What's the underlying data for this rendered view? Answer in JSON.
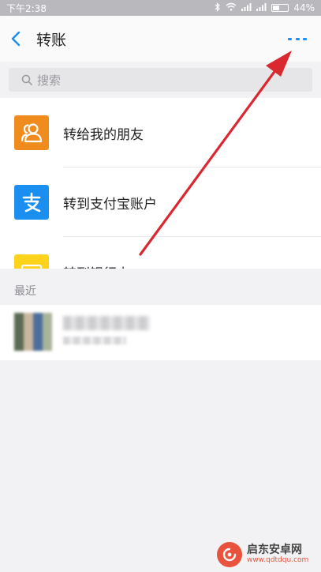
{
  "status_bar": {
    "time": "下午2:38",
    "battery": "44%",
    "battery_level": 0.44
  },
  "header": {
    "title": "转账",
    "back_icon": "chevron-left-icon",
    "more_icon": "more-dots-icon",
    "accent_color": "#1a8ff0"
  },
  "search": {
    "placeholder": "搜索"
  },
  "transfer_options": [
    {
      "label": "转给我的朋友",
      "icon": "contacts-icon",
      "color": "#f08b1e"
    },
    {
      "label": "转到支付宝账户",
      "icon": "alipay-icon",
      "color": "#1a8ff0"
    },
    {
      "label": "转到银行卡",
      "icon": "bank-card-icon",
      "color": "#ffd21c"
    }
  ],
  "recent": {
    "header": "最近"
  },
  "watermark": {
    "title": "启东安卓网",
    "url": "www.qdtdqu.com"
  }
}
